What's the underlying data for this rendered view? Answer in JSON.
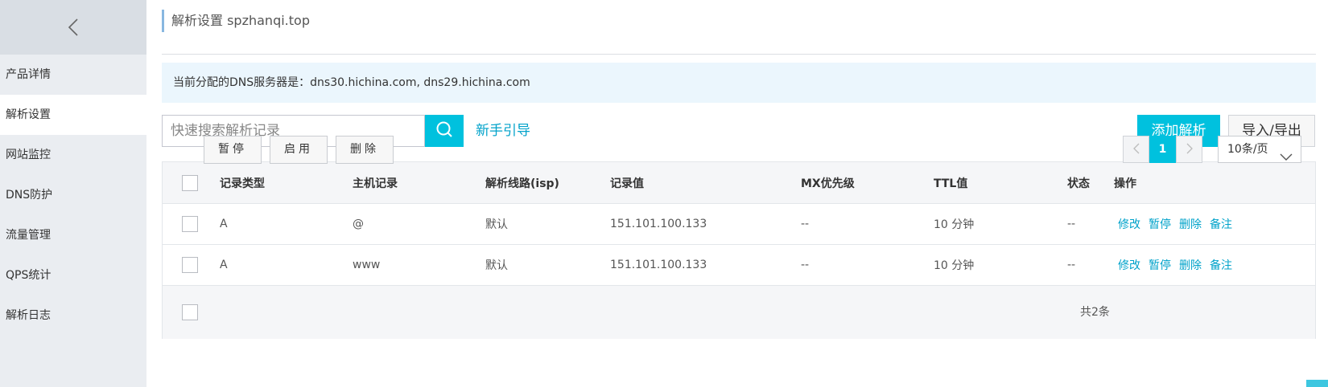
{
  "sidebar": {
    "back_icon": "chevron-left-icon",
    "items": [
      {
        "label": "产品详情"
      },
      {
        "label": "解析设置"
      },
      {
        "label": "网站监控"
      },
      {
        "label": "DNS防护"
      },
      {
        "label": "流量管理"
      },
      {
        "label": "QPS统计"
      },
      {
        "label": "解析日志"
      }
    ],
    "active_item": "解析设置"
  },
  "header": {
    "title": "解析设置 spzhanqi.top"
  },
  "dns_banner": {
    "text": "当前分配的DNS服务器是：dns30.hichina.com, dns29.hichina.com"
  },
  "toolbar": {
    "search_placeholder": "快速搜索解析记录",
    "search_icon": "search-icon",
    "guide_label": "新手引导",
    "add_label": "添加解析",
    "import_export_label": "导入/导出"
  },
  "table": {
    "columns": [
      "记录类型",
      "主机记录",
      "解析线路(isp)",
      "记录值",
      "MX优先级",
      "TTL值",
      "状态",
      "操作"
    ],
    "rows": [
      {
        "type": "A",
        "host": "@",
        "line": "默认",
        "value": "151.101.100.133",
        "mx": "--",
        "ttl": "10 分钟",
        "status": "--",
        "ops": [
          "修改",
          "暂停",
          "删除",
          "备注"
        ]
      },
      {
        "type": "A",
        "host": "www",
        "line": "默认",
        "value": "151.101.100.133",
        "mx": "--",
        "ttl": "10 分钟",
        "status": "--",
        "ops": [
          "修改",
          "暂停",
          "删除",
          "备注"
        ]
      }
    ]
  },
  "footer": {
    "pause_label": "暂停",
    "enable_label": "启用",
    "delete_label": "删除",
    "total_label": "共2条",
    "current_page": "1",
    "page_size_label": "10条/页"
  },
  "colors": {
    "accent": "#00c1de",
    "link": "#00a2ca",
    "sidebar_bg": "#eaedf1",
    "banner_bg": "#ebf6fd"
  }
}
